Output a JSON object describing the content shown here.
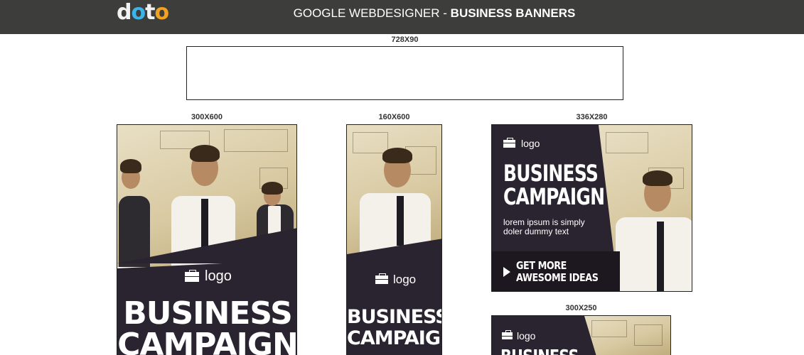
{
  "header": {
    "brand": {
      "d": "d",
      "o1": "o",
      "t": "t",
      "o2": "o"
    },
    "title_prefix": "GOOGLE WEBDESIGNER - ",
    "title_bold": "BUSINESS BANNERS"
  },
  "banners": {
    "leaderboard": {
      "size": "728X90"
    },
    "half_page": {
      "size": "300X600",
      "logo": "logo",
      "headline_1": "BUSINESS",
      "headline_2": "CAMPAIGN"
    },
    "skyscraper": {
      "size": "160X600",
      "logo": "logo",
      "headline_1": "BUSINESS",
      "headline_2": "CAMPAIGN"
    },
    "large_rectangle": {
      "size": "336X280",
      "logo": "logo",
      "headline_1": "BUSINESS",
      "headline_2": "CAMPAIGN",
      "body_1": "lorem ipsum is simply",
      "body_2": "doler dummy text",
      "cta_1": "GET MORE",
      "cta_2": "AWESOME IDEAS"
    },
    "medium_rectangle": {
      "size": "300X250",
      "logo": "logo",
      "headline_1": "BUSINESS"
    }
  },
  "colors": {
    "topbar": "#3d3d3b",
    "banner_dark": "#2a2430",
    "photo": "#d8c9a1"
  }
}
